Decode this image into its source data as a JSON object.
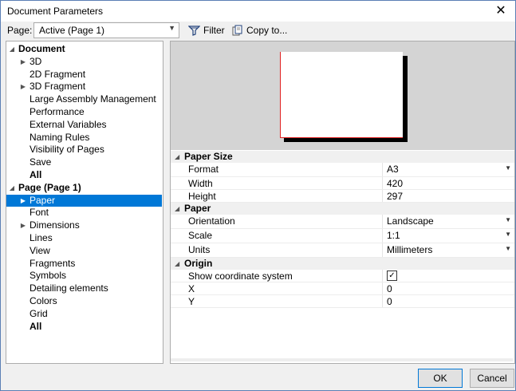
{
  "window": {
    "title": "Document Parameters"
  },
  "toolbar": {
    "page_label": "Page:",
    "page_value": "Active (Page 1)",
    "filter_label": "Filter",
    "copy_label": "Copy to..."
  },
  "tree": [
    {
      "label": "Document",
      "bold": true,
      "level": 0,
      "expander": "expanded",
      "selected": false
    },
    {
      "label": "3D",
      "bold": false,
      "level": 1,
      "expander": "collapsed",
      "selected": false
    },
    {
      "label": "2D Fragment",
      "bold": false,
      "level": 1,
      "expander": "none",
      "selected": false
    },
    {
      "label": "3D Fragment",
      "bold": false,
      "level": 1,
      "expander": "collapsed",
      "selected": false
    },
    {
      "label": "Large Assembly Management",
      "bold": false,
      "level": 1,
      "expander": "none",
      "selected": false
    },
    {
      "label": "Performance",
      "bold": false,
      "level": 1,
      "expander": "none",
      "selected": false
    },
    {
      "label": "External Variables",
      "bold": false,
      "level": 1,
      "expander": "none",
      "selected": false
    },
    {
      "label": "Naming Rules",
      "bold": false,
      "level": 1,
      "expander": "none",
      "selected": false
    },
    {
      "label": "Visibility of Pages",
      "bold": false,
      "level": 1,
      "expander": "none",
      "selected": false
    },
    {
      "label": "Save",
      "bold": false,
      "level": 1,
      "expander": "none",
      "selected": false
    },
    {
      "label": "All",
      "bold": true,
      "level": 1,
      "expander": "none",
      "selected": false
    },
    {
      "label": "Page (Page 1)",
      "bold": true,
      "level": 0,
      "expander": "expanded",
      "selected": false
    },
    {
      "label": "Paper",
      "bold": false,
      "level": 1,
      "expander": "collapsed",
      "selected": true
    },
    {
      "label": "Font",
      "bold": false,
      "level": 1,
      "expander": "none",
      "selected": false
    },
    {
      "label": "Dimensions",
      "bold": false,
      "level": 1,
      "expander": "collapsed",
      "selected": false
    },
    {
      "label": "Lines",
      "bold": false,
      "level": 1,
      "expander": "none",
      "selected": false
    },
    {
      "label": "View",
      "bold": false,
      "level": 1,
      "expander": "none",
      "selected": false
    },
    {
      "label": "Fragments",
      "bold": false,
      "level": 1,
      "expander": "none",
      "selected": false
    },
    {
      "label": "Symbols",
      "bold": false,
      "level": 1,
      "expander": "none",
      "selected": false
    },
    {
      "label": "Detailing elements",
      "bold": false,
      "level": 1,
      "expander": "none",
      "selected": false
    },
    {
      "label": "Colors",
      "bold": false,
      "level": 1,
      "expander": "none",
      "selected": false
    },
    {
      "label": "Grid",
      "bold": false,
      "level": 1,
      "expander": "none",
      "selected": false
    },
    {
      "label": "All",
      "bold": true,
      "level": 1,
      "expander": "none",
      "selected": false
    }
  ],
  "properties": [
    {
      "category": "Paper Size",
      "rows": [
        {
          "name": "Format",
          "value": "A3",
          "dropdown": true
        },
        {
          "name": "Width",
          "value": "420",
          "dropdown": false
        },
        {
          "name": "Height",
          "value": "297",
          "dropdown": false
        }
      ]
    },
    {
      "category": "Paper",
      "rows": [
        {
          "name": "Orientation",
          "value": "Landscape",
          "dropdown": true
        },
        {
          "name": "Scale",
          "value": "1:1",
          "dropdown": true
        },
        {
          "name": "Units",
          "value": "Millimeters",
          "dropdown": true
        }
      ]
    },
    {
      "category": "Origin",
      "rows": [
        {
          "name": "Show coordinate system",
          "checkbox": true,
          "checked": true
        },
        {
          "name": "X",
          "value": "0",
          "dropdown": false
        },
        {
          "name": "Y",
          "value": "0",
          "dropdown": false
        }
      ]
    }
  ],
  "buttons": {
    "ok": "OK",
    "cancel": "Cancel"
  },
  "colors": {
    "selection": "#0078d7",
    "paper_edge": "#e02020",
    "preview_bg": "#d4d4d4"
  }
}
